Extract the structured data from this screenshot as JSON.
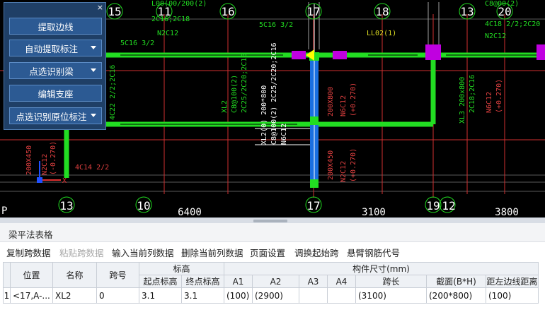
{
  "panel": {
    "close_glyph": "×",
    "buttons": [
      {
        "label": "提取边线",
        "has_dropdown": false
      },
      {
        "label": "自动提取标注",
        "has_dropdown": true
      },
      {
        "label": "点选识别梁",
        "has_dropdown": true
      },
      {
        "label": "编辑支座",
        "has_dropdown": false
      },
      {
        "label": "点选识别原位标注",
        "has_dropdown": true
      }
    ]
  },
  "cad": {
    "axis_top": [
      "15",
      "11",
      "16",
      "17",
      "18",
      "13",
      "20"
    ],
    "axis_bottom": [
      "13",
      "10",
      "17",
      "19",
      "12"
    ],
    "dims_bottom": [
      "6400",
      "3100",
      "3800"
    ],
    "annotations": {
      "t1": "L00(00/200(2)",
      "t2": "2C16;2C18",
      "t3": "N2C12",
      "t4": "5C16 3/2",
      "t5": "5C16 3/2",
      "t6": "LL02(1)",
      "t7": "C8@00(2)",
      "t8": "4C18 2/2;2C20",
      "t9": "N2C12",
      "t10": "4C22 2/2;2C16",
      "t11": "XL2",
      "t12": "C8@100(2)",
      "t13": "2C25/2C20;2C16",
      "t14": "XL2(0) 200*800",
      "t15": "C8@100(2) 2C25/2C20;2C16",
      "t16": "N6C12",
      "t17": "200X800",
      "t18": "N6C12",
      "t19": "(+0.270)",
      "t20": "XL3 200x800",
      "t21": "2C18;2C16",
      "t22": "N6C12",
      "t23": "(+0.270)",
      "t24": "200X450",
      "t25": "N2C12",
      "t26": "(-0.270)",
      "t27": "4C14 2/2",
      "t28": "200X450",
      "t29": "N2C12",
      "t30": "(+0.270)",
      "t31": "X",
      "t32": "P"
    },
    "colors": {
      "beam_green": "#22dd22",
      "support_magenta": "#c000e0",
      "axis_red": "#d03030",
      "selected_blue": "#1a6fe0"
    }
  },
  "table_panel": {
    "title": "梁平法表格",
    "toolbar": [
      {
        "label": "复制跨数据",
        "enabled": true
      },
      {
        "label": "粘贴跨数据",
        "enabled": false
      },
      {
        "label": "输入当前列数据",
        "enabled": true
      },
      {
        "label": "删除当前列数据",
        "enabled": true
      },
      {
        "label": "页面设置",
        "enabled": true
      },
      {
        "label": "调换起始跨",
        "enabled": true
      },
      {
        "label": "悬臂钢筋代号",
        "enabled": true
      }
    ],
    "headers": {
      "position": "位置",
      "name": "名称",
      "span_no": "跨号",
      "elevation": "标高",
      "start_elev": "起点标高",
      "end_elev": "终点标高",
      "dims": "构件尺寸(mm)",
      "a1": "A1",
      "a2": "A2",
      "a3": "A3",
      "a4": "A4",
      "span_len": "跨长",
      "section": "截面(B*H)",
      "edge_dist": "距左边线距离"
    },
    "rows": [
      {
        "index": "1",
        "position": "<17,A-...",
        "name": "XL2",
        "span_no": "0",
        "start_elev": "3.1",
        "end_elev": "3.1",
        "a1": "(100)",
        "a2": "(2900)",
        "a3": "",
        "a4": "",
        "span_len": "(3100)",
        "section": "(200*800)",
        "edge_dist": "(100)"
      }
    ]
  }
}
